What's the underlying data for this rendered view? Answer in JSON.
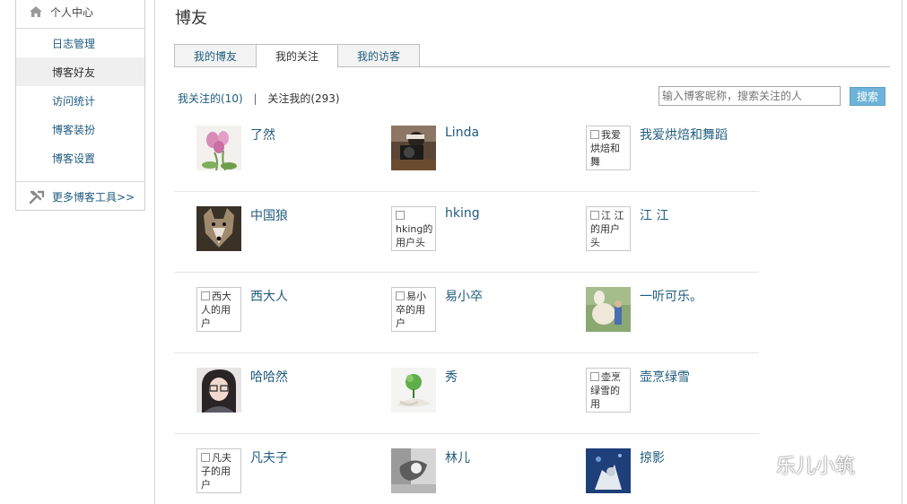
{
  "sidebar": {
    "header": "个人中心",
    "items": [
      {
        "label": "日志管理",
        "active": false
      },
      {
        "label": "博客好友",
        "active": true
      },
      {
        "label": "访问统计",
        "active": false
      },
      {
        "label": "博客装扮",
        "active": false
      },
      {
        "label": "博客设置",
        "active": false
      }
    ],
    "footer": "更多博客工具>>"
  },
  "main": {
    "title": "博友",
    "tabs": [
      {
        "label": "我的博友",
        "active": false
      },
      {
        "label": "我的关注",
        "active": true
      },
      {
        "label": "我的访客",
        "active": false
      }
    ],
    "filter": {
      "following": "我关注的(10)",
      "separator": "|",
      "followers": "关注我的(293)"
    },
    "search": {
      "placeholder": "输入博客昵称，搜索关注的人",
      "button": "搜索"
    },
    "friends": [
      [
        {
          "name": "了然",
          "avatar": "flower-photo"
        },
        {
          "name": "Linda",
          "avatar": "camera-photo"
        },
        {
          "name": "我爱烘焙和舞蹈",
          "avatar": "broken",
          "alt": "我爱烘焙和舞"
        }
      ],
      [
        {
          "name": "中国狼",
          "avatar": "wolf-photo"
        },
        {
          "name": "hking",
          "avatar": "broken",
          "alt": "hking的用户头"
        },
        {
          "name": "江 江",
          "avatar": "broken",
          "alt": "江 江的用户头"
        }
      ],
      [
        {
          "name": "西大人",
          "avatar": "broken",
          "alt": "西大人的用户"
        },
        {
          "name": "易小卒",
          "avatar": "broken",
          "alt": "易小卒的用户"
        },
        {
          "name": "一听可乐。",
          "avatar": "alpaca-photo"
        }
      ],
      [
        {
          "name": "哈哈然",
          "avatar": "girl-photo"
        },
        {
          "name": "秀",
          "avatar": "plant-photo"
        },
        {
          "name": "壶烹绿雪",
          "avatar": "broken",
          "alt": "壶烹绿雪的用"
        }
      ],
      [
        {
          "name": "凡夫子",
          "avatar": "broken",
          "alt": "凡夫子的用户"
        },
        {
          "name": "林儿",
          "avatar": "gray-photo"
        },
        {
          "name": "掠影",
          "avatar": "blue-photo"
        }
      ]
    ]
  },
  "watermark": "乐儿小筑",
  "colors": {
    "link": "#1f5b7d",
    "button": "#6fb4d8",
    "border": "#cfcfcf"
  }
}
